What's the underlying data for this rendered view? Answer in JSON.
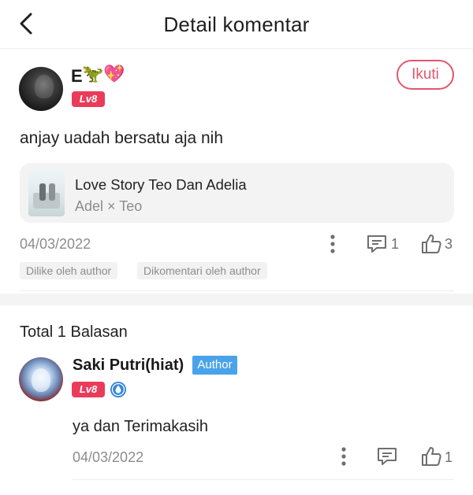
{
  "header": {
    "title": "Detail komentar"
  },
  "comment": {
    "username": "E",
    "emojis": [
      "🦖",
      "💖"
    ],
    "level": "Lv8",
    "follow_label": "Ikuti",
    "text": "anjay uadah bersatu aja nih",
    "story": {
      "title": "Love Story Teo Dan Adelia",
      "authors": "Adel × Teo"
    },
    "date": "04/03/2022",
    "reply_count": "1",
    "like_count": "3",
    "tags": [
      "Dilike oleh author",
      "Dikomentari oleh author"
    ]
  },
  "replies": {
    "total_label": "Total 1 Balasan",
    "items": [
      {
        "username": "Saki Putri(hiat)",
        "badge": "Author",
        "level": "Lv8",
        "text": "ya dan Terimakasih",
        "date": "04/03/2022",
        "like_count": "1"
      }
    ]
  },
  "colors": {
    "accent": "#e2566e",
    "level_badge": "#ea3b5a",
    "author_badge": "#4aa3ea",
    "verified_badge": "#2f86d8",
    "muted_text": "#8c8c8c",
    "icon_gray": "#6f6f6f"
  },
  "icons": [
    "chevron-left-icon",
    "more-vertical-icon",
    "comment-icon",
    "thumbs-up-icon",
    "verified-drop-icon"
  ]
}
